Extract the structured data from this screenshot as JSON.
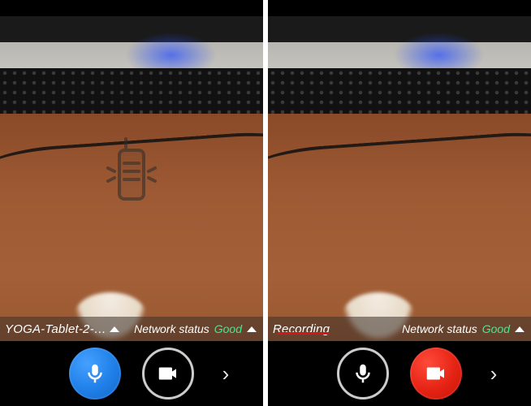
{
  "left": {
    "title": "YOGA-Tablet-2-…",
    "network_label": "Network status",
    "network_value": "Good",
    "icons": {
      "walkie": "walkie-talkie-icon",
      "mic": "microphone-icon",
      "video": "video-camera-icon",
      "more": "›"
    }
  },
  "right": {
    "title": "Recording",
    "network_label": "Network status",
    "network_value": "Good",
    "icons": {
      "mic": "microphone-icon",
      "video": "video-camera-icon",
      "more": "›"
    }
  }
}
